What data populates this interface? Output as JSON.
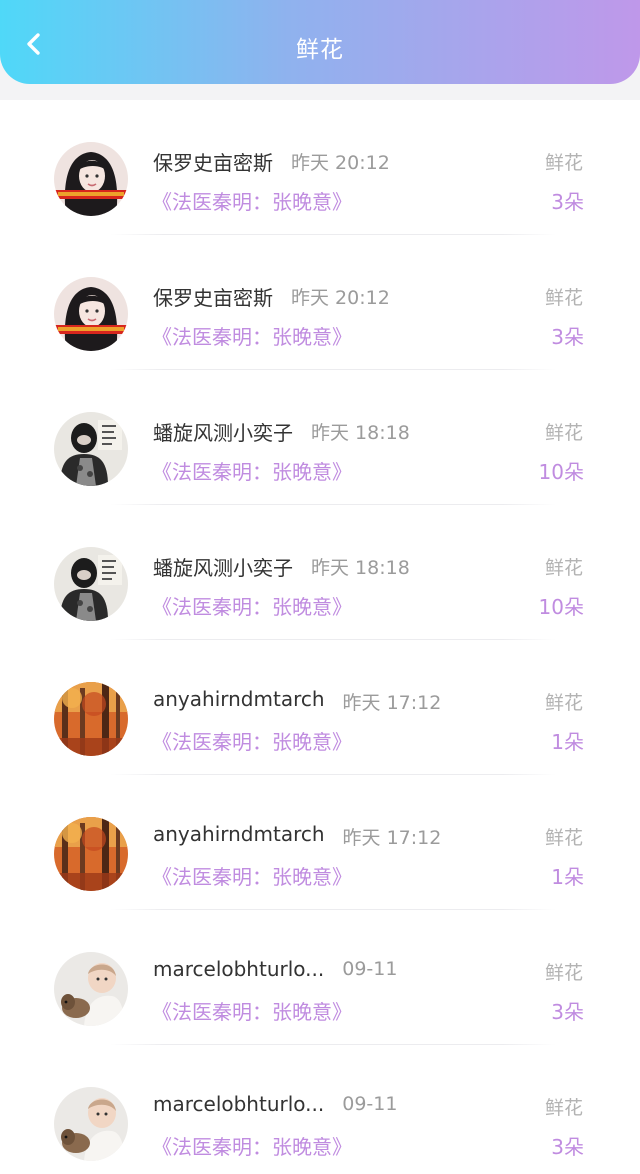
{
  "header": {
    "title": "鲜花",
    "background_gradient": [
      "#4fd8f8",
      "#8fb2ee",
      "#bf98ea"
    ]
  },
  "colors": {
    "accent": "#c08ce0",
    "name_text": "#333333",
    "meta_text": "#9b9b9b"
  },
  "records": [
    {
      "user": "保罗史亩密斯",
      "time": "昨天 20:12",
      "book": "《法医秦明：张晚意》",
      "gift": "鲜花",
      "count": "3朵",
      "avatar": "girl-photo"
    },
    {
      "user": "保罗史亩密斯",
      "time": "昨天 20:12",
      "book": "《法医秦明：张晚意》",
      "gift": "鲜花",
      "count": "3朵",
      "avatar": "girl-photo"
    },
    {
      "user": "蟠旋风测小奕子",
      "time": "昨天 18:18",
      "book": "《法医秦明：张晚意》",
      "gift": "鲜花",
      "count": "10朵",
      "avatar": "masked-person"
    },
    {
      "user": "蟠旋风测小奕子",
      "time": "昨天 18:18",
      "book": "《法医秦明：张晚意》",
      "gift": "鲜花",
      "count": "10朵",
      "avatar": "masked-person"
    },
    {
      "user": "anyahirndmtarch",
      "time": "昨天 17:12",
      "book": "《法医秦明：张晚意》",
      "gift": "鲜花",
      "count": "1朵",
      "avatar": "autumn-forest"
    },
    {
      "user": "anyahirndmtarch",
      "time": "昨天 17:12",
      "book": "《法医秦明：张晚意》",
      "gift": "鲜花",
      "count": "1朵",
      "avatar": "autumn-forest"
    },
    {
      "user": "marcelobhturlo...",
      "time": "09-11",
      "book": "《法医秦明：张晚意》",
      "gift": "鲜花",
      "count": "3朵",
      "avatar": "baby-and-puppy"
    },
    {
      "user": "marcelobhturlo...",
      "time": "09-11",
      "book": "《法医秦明：张晚意》",
      "gift": "鲜花",
      "count": "3朵",
      "avatar": "baby-and-puppy"
    }
  ]
}
